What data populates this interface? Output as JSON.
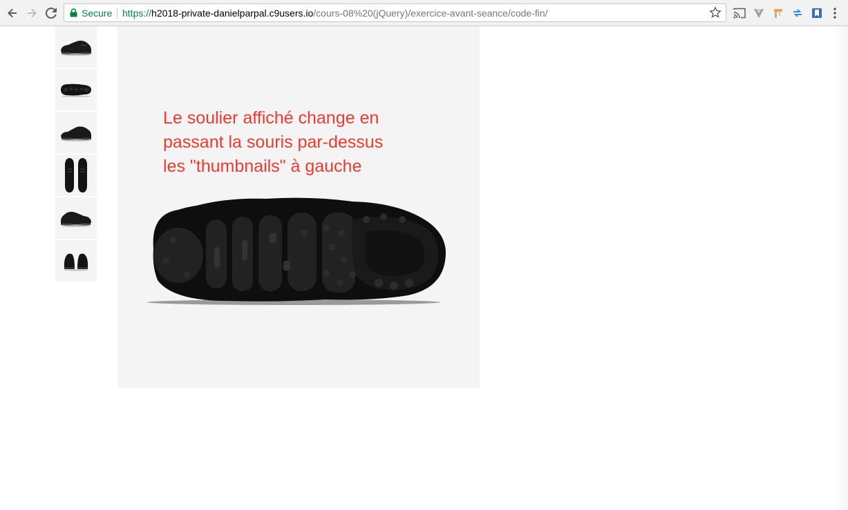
{
  "browser": {
    "secure_label": "Secure",
    "url_scheme": "https://",
    "url_host": "h2018-private-danielparpal.c9users.io",
    "url_path": "/cours-08%20(jQuery)/exercice-avant-seance/code-fin/",
    "icons": [
      "back-icon",
      "forward-icon",
      "reload-icon",
      "lock-icon",
      "bookmark-star-icon",
      "cast-icon",
      "extension-v-icon",
      "extension-tool-icon",
      "extension-arrows-icon",
      "extension-bookmark-icon",
      "more-menu-icon"
    ]
  },
  "page": {
    "caption_lines": [
      "Le soulier affiché change en",
      "passant la souris par-dessus",
      "les \"thumbnails\" à gauche"
    ],
    "caption_color": "#f03a2e",
    "thumbnails": [
      {
        "view": "side"
      },
      {
        "view": "sole"
      },
      {
        "view": "side-angle"
      },
      {
        "view": "top"
      },
      {
        "view": "side-other"
      },
      {
        "view": "front"
      }
    ],
    "main_image": {
      "view": "sole"
    }
  }
}
